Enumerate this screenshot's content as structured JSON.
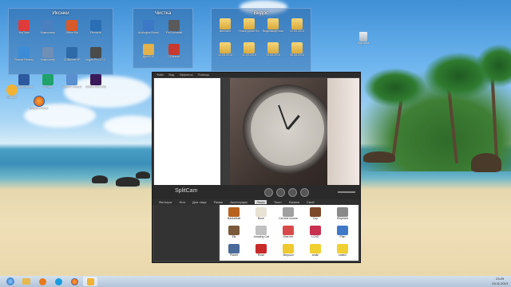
{
  "desktop": {
    "groups": [
      {
        "title": "Иконки",
        "icons": [
          {
            "label": "YouTube",
            "color": "#e03b3b"
          },
          {
            "label": "Компьютер",
            "color": "#4a7fc0"
          },
          {
            "label": "Office Mo",
            "color": "#d65a2a"
          },
          {
            "label": "Pinnacle",
            "color": "#2a6fb4"
          },
          {
            "label": "Format Factory",
            "color": "#3b8bd6"
          },
          {
            "label": "Компьютер",
            "color": "#6f8fb6"
          },
          {
            "label": "CDBurnerXP",
            "color": "#2e6aa8"
          },
          {
            "label": "Vegas Pro 12.0 (64-bit)",
            "color": "#4b4b4b"
          },
          {
            "label": "Google Планет",
            "color": "#2d5a9e"
          },
          {
            "label": "M-Sofe",
            "color": "#1fa36a"
          },
          {
            "label": "Anvsoft Snap 6",
            "color": "#5a8fd0"
          },
          {
            "label": "Adobe After Effects CS6",
            "color": "#3a1a5a"
          }
        ]
      },
      {
        "title": "Чистка",
        "icons": [
          {
            "label": "Auslogics BoostSpeed",
            "color": "#3b79c7"
          },
          {
            "label": "Full Uninstall",
            "color": "#5a5a5a"
          },
          {
            "label": "Дрh2013",
            "color": "#e3b24a"
          },
          {
            "label": "CCleaner",
            "color": "#c83a2e"
          }
        ]
      },
      {
        "title": "Видос",
        "icons": [
          {
            "label": "масляно",
            "color": "#e3b24a"
          },
          {
            "label": "Новогодняя Плавдня",
            "color": "#e3b24a"
          },
          {
            "label": "Видеовиде кошачье",
            "color": "#e3b24a"
          },
          {
            "label": "12.09.2013",
            "color": "#e3b24a"
          },
          {
            "label": "12.08.2013",
            "color": "#e3b24a"
          },
          {
            "label": "11.09.2013",
            "color": "#e3b24a"
          },
          {
            "label": "10.08.2013",
            "color": "#e3b24a"
          },
          {
            "label": "08.08.2013",
            "color": "#e3b24a"
          }
        ]
      }
    ],
    "recycle_label": "Корзина",
    "loose_icons": [
      {
        "label": "Shazam",
        "color": "#f2b233"
      },
      {
        "label": "Mozilla Firefox",
        "color": "#e06b1f"
      }
    ]
  },
  "app": {
    "menu": [
      "Файл",
      "Вид",
      "Эффекты",
      "Помощь"
    ],
    "brand": "SplitCam",
    "tabs": [
      "Фильтры",
      "Фон",
      "Для лица",
      "Рамки",
      "Аксессуары",
      "Ломы",
      "Текст",
      "Вазики",
      "Свой"
    ],
    "gallery": [
      {
        "label": "Basketball",
        "color": "#b8611c"
      },
      {
        "label": "Bone",
        "color": "#e8e2d4"
      },
      {
        "label": "Cat and mouse",
        "color": "#a0a0a0"
      },
      {
        "label": "Cup",
        "color": "#7a4a2a"
      },
      {
        "label": "Elephant",
        "color": "#8a8a8a"
      },
      {
        "label": "Elk",
        "color": "#7a5a3a"
      },
      {
        "label": "Jumping Cat",
        "color": "#c0c0c0"
      },
      {
        "label": "Kiss me",
        "color": "#d84a4a"
      },
      {
        "label": "LOVE",
        "color": "#c83050"
      },
      {
        "label": "Plan",
        "color": "#3f78c8"
      },
      {
        "label": "Planet",
        "color": "#4a6a9a"
      },
      {
        "label": "Rose",
        "color": "#c82a2a"
      },
      {
        "label": "Simpson",
        "color": "#f0c830"
      },
      {
        "label": "smile",
        "color": "#f0d030"
      },
      {
        "label": "smile2",
        "color": "#f0d030"
      }
    ]
  },
  "taskbar": {
    "time": "23:29",
    "date": "03.11.2013",
    "apps": [
      "start-orb",
      "windows-explorer",
      "player",
      "skype",
      "firefox",
      "splitcam"
    ]
  }
}
